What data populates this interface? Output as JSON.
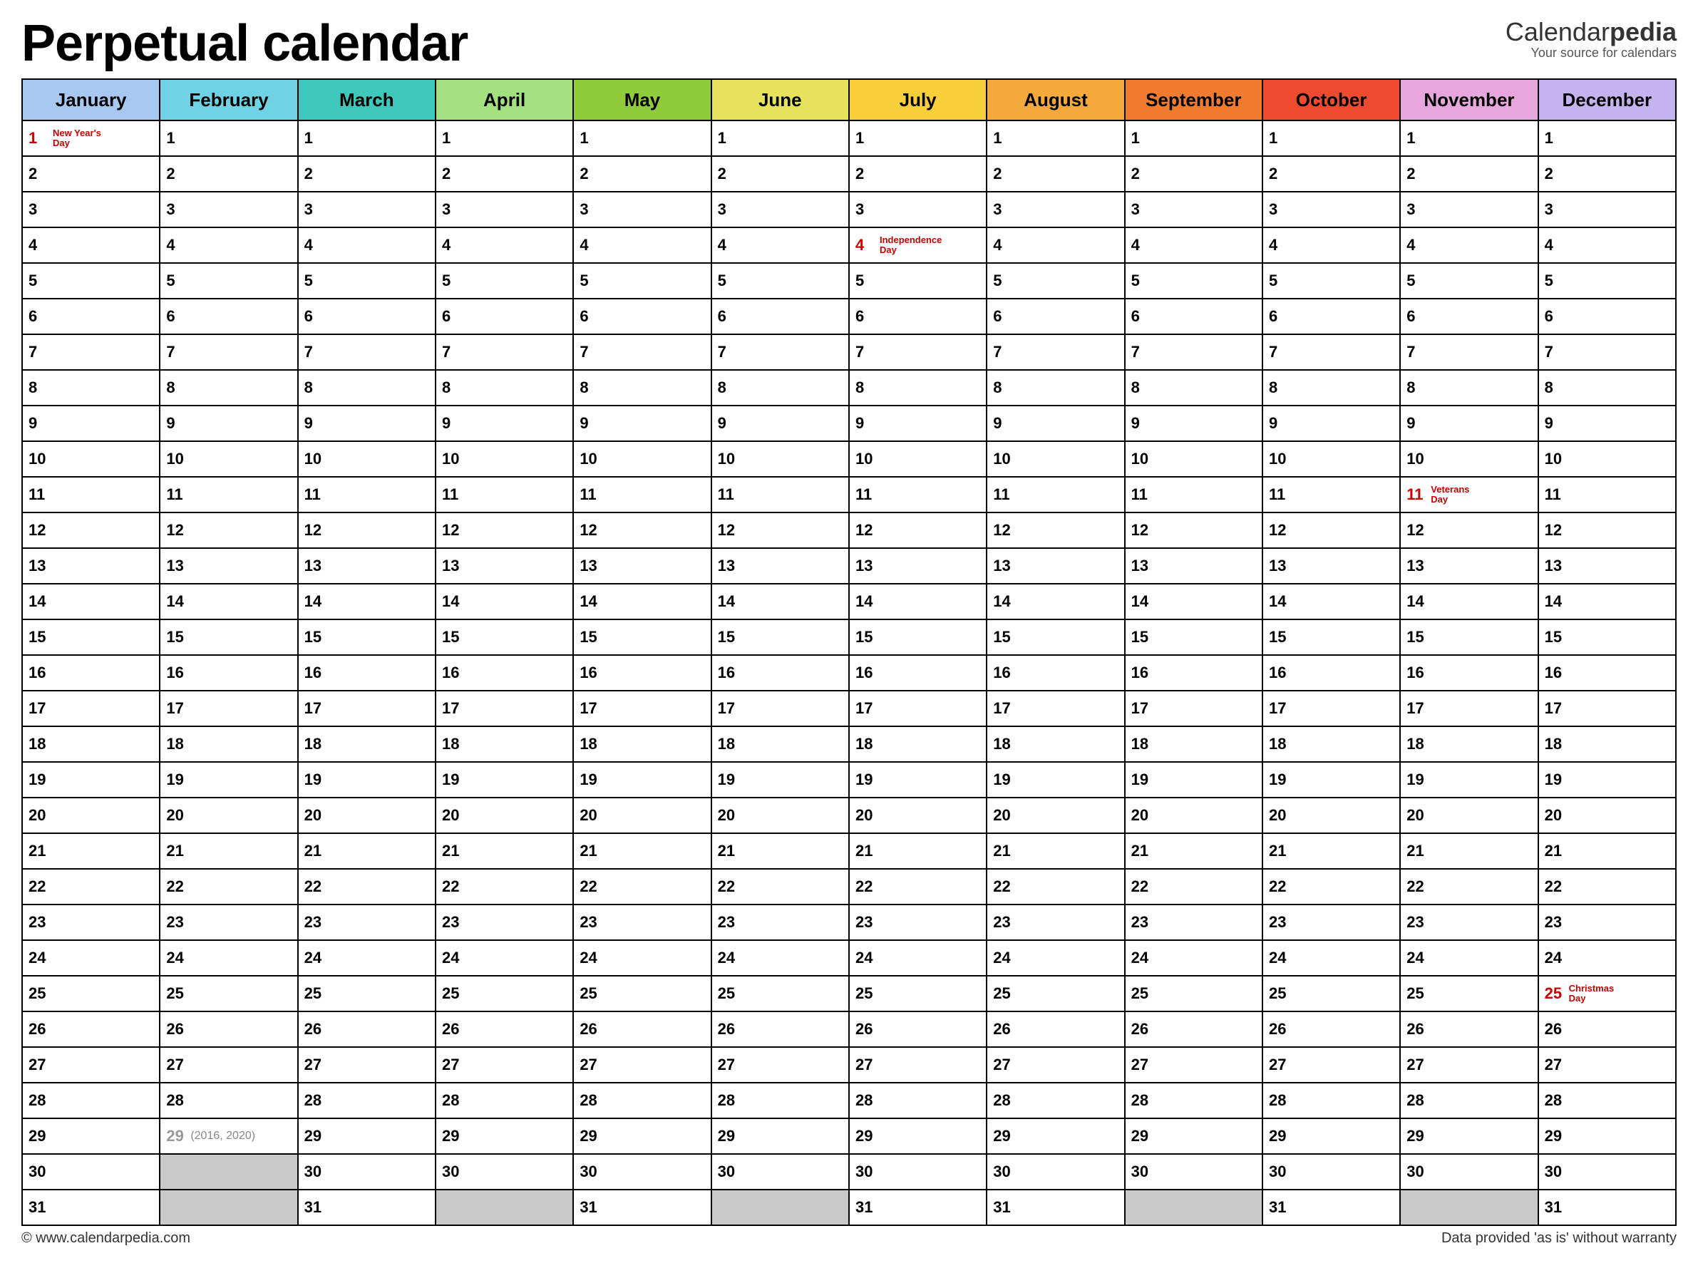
{
  "title": "Perpetual calendar",
  "brand": {
    "part1": "Calendar",
    "part2": "pedia",
    "tagline": "Your source for calendars"
  },
  "months": [
    {
      "name": "January",
      "color": "#a7c9f1",
      "days": 31
    },
    {
      "name": "February",
      "color": "#6fd2e5",
      "days": 29,
      "leap": true
    },
    {
      "name": "March",
      "color": "#3ec7bb",
      "days": 31
    },
    {
      "name": "April",
      "color": "#a3e07f",
      "days": 30
    },
    {
      "name": "May",
      "color": "#8fcb3b",
      "days": 31
    },
    {
      "name": "June",
      "color": "#e6e25c",
      "days": 30
    },
    {
      "name": "July",
      "color": "#f7cf3a",
      "days": 31
    },
    {
      "name": "August",
      "color": "#f5a93a",
      "days": 31
    },
    {
      "name": "September",
      "color": "#f07a2d",
      "days": 30
    },
    {
      "name": "October",
      "color": "#ed4a2f",
      "days": 31
    },
    {
      "name": "November",
      "color": "#e7a7dd",
      "days": 30
    },
    {
      "name": "December",
      "color": "#c3b4ef",
      "days": 31
    }
  ],
  "max_days": 31,
  "leap_note": "(2016, 2020)",
  "holidays": {
    "January": {
      "1": "New Year's Day"
    },
    "July": {
      "4": "Independence Day"
    },
    "November": {
      "11": "Veterans Day"
    },
    "December": {
      "25": "Christmas Day"
    }
  },
  "footer": {
    "left": "© www.calendarpedia.com",
    "right": "Data provided 'as is' without warranty"
  }
}
